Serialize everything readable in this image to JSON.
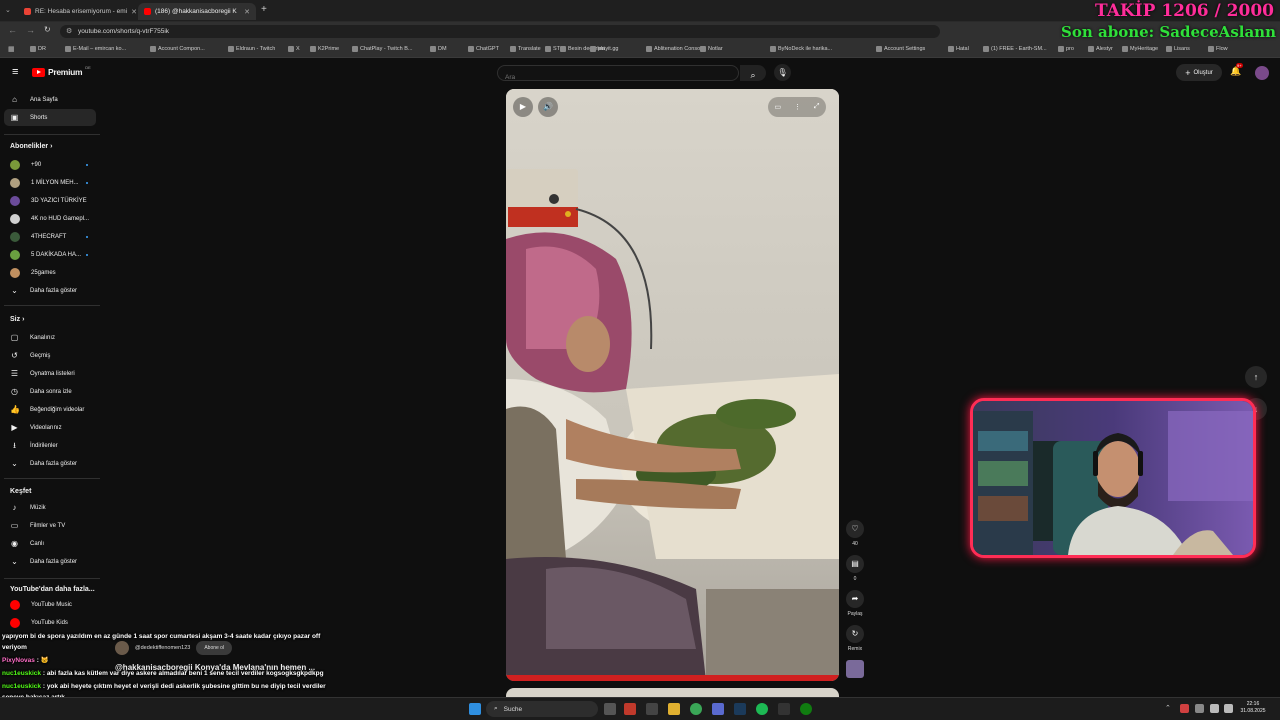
{
  "browser": {
    "tabs": [
      {
        "title": "RE: Hesaba erisemiyorum - emi",
        "favicon_color": "#ea4335",
        "active": false
      },
      {
        "title": "(186) @hakkanisacboregii K",
        "favicon_color": "#ff0000",
        "active": true
      }
    ],
    "new_tab_label": "+",
    "url": "youtube.com/shorts/q-vtrF755ik",
    "bookmarks": [
      "DR",
      "E-Mail – emircan ko...",
      "Account Compon...",
      "Eldraun - Twitch",
      "X",
      "K2Prime",
      "ChatPlay - Twitch B...",
      "DM",
      "ChatGPT",
      "Translate",
      "STO",
      "Besin degerleri",
      "playit.gg",
      "Ablitenation Console",
      "Notlar",
      "ByNoDeck ile harika...",
      "Account Settings",
      "Hatal",
      "(1) FREE - Earth-SM...",
      "pro",
      "Alestyr",
      "MyHeritage",
      "Lisans",
      "Flow"
    ]
  },
  "youtube": {
    "logo": "Premium",
    "logo_badge": "DE",
    "search_placeholder": "Ara",
    "create_label": "Oluştur",
    "notif_count": "9+",
    "sidebar": {
      "top": [
        {
          "label": "Ana Sayfa",
          "icon": "home-icon",
          "selected": false
        },
        {
          "label": "Shorts",
          "icon": "shorts-icon",
          "selected": true
        }
      ],
      "subs_header": "Abonelikler",
      "subs": [
        {
          "label": "+90",
          "color": "#7a9a3a",
          "dot": true
        },
        {
          "label": "1 MİLYON MEH...",
          "color": "#b0a080",
          "dot": true
        },
        {
          "label": "3D YAZICI TÜRKİYE",
          "color": "#6b4b9a",
          "dot": false
        },
        {
          "label": "4K no HUD Gamepl...",
          "color": "#d0d0d0",
          "dot": false
        },
        {
          "label": "4THECRAFT",
          "color": "#3a5a3a",
          "dot": true
        },
        {
          "label": "5 DAKİKADA HA...",
          "color": "#6aa040",
          "dot": true
        },
        {
          "label": "25games",
          "color": "#c09060",
          "dot": false
        }
      ],
      "subs_more": "Daha fazla göster",
      "you_header": "Siz",
      "you": [
        {
          "label": "Kanalınız",
          "icon": "channel-icon"
        },
        {
          "label": "Geçmiş",
          "icon": "history-icon"
        },
        {
          "label": "Oynatma listeleri",
          "icon": "playlist-icon"
        },
        {
          "label": "Daha sonra izle",
          "icon": "clock-icon"
        },
        {
          "label": "Beğendiğim videolar",
          "icon": "like-icon"
        },
        {
          "label": "Videolarınız",
          "icon": "video-icon"
        },
        {
          "label": "İndirilenler",
          "icon": "download-icon"
        }
      ],
      "you_more": "Daha fazla göster",
      "explore_header": "Keşfet",
      "explore": [
        {
          "label": "Müzik",
          "icon": "music-icon"
        },
        {
          "label": "Filmler ve TV",
          "icon": "film-icon"
        },
        {
          "label": "Canlı",
          "icon": "live-icon"
        }
      ],
      "explore_more": "Daha fazla göster",
      "more_header": "YouTube'dan daha fazla...",
      "more": [
        {
          "label": "YouTube Music",
          "color": "#ff0000"
        },
        {
          "label": "YouTube Kids",
          "color": "#ff0000"
        }
      ]
    },
    "short": {
      "channel": "@dedektiffenomen123",
      "subscribe_label": "Abone ol",
      "title": "@hakkanisacboregii Konya'da Mevlana'nın hemen ...",
      "likes": "40",
      "comments": "0",
      "share_label": "Paylaş",
      "remix_label": "Remix"
    }
  },
  "overlay": {
    "follow_goal": "TAKİP 1206 / 2000",
    "last_sub": "Son abone: SadeceAslann",
    "chat": [
      {
        "user": "",
        "text": "yapıyom bi de spora yazıldım en az günde 1 saat spor cumartesi akşam 3-4 saate kadar çıkıyo pazar off veriyom",
        "user_color": "#ffffff"
      },
      {
        "user": "PixyNovas",
        "text": "🐱",
        "user_color": "#ff6ec7"
      },
      {
        "user": "nuc1euskick",
        "text": "abi fazla kas kütlem var diye askere almadılar beni 1 sene tecil verdiler kogsogksgkpdkpg",
        "user_color": "#53fc18"
      },
      {
        "user": "nuc1euskick",
        "text": "yok abi heyete çıktım heyet el verişli dedi askerlik şubesine gittim bu ne diyip tecil verdiler seneye bakıcaz artık",
        "user_color": "#53fc18"
      }
    ]
  },
  "taskbar": {
    "search_label": "Suche",
    "time": "22:16",
    "date": "31.08.2025"
  }
}
